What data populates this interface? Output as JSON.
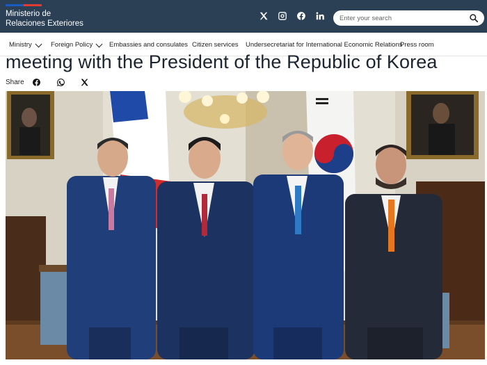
{
  "header": {
    "org_line1": "Ministerio de",
    "org_line2": "Relaciones Exteriores",
    "search_placeholder": "Enter your search",
    "social_icons": [
      "x-icon",
      "instagram-icon",
      "facebook-icon",
      "linkedin-icon"
    ],
    "colors": {
      "bar": "#2b3f55",
      "flag_blue": "#1a5cc4",
      "flag_red": "#e03c31"
    }
  },
  "nav": {
    "items": [
      {
        "label": "Ministry",
        "dropdown": true
      },
      {
        "label": "Foreign Policy",
        "dropdown": true
      },
      {
        "label": "Embassies and consulates",
        "dropdown": false
      },
      {
        "label": "Citizen services",
        "dropdown": false
      },
      {
        "label": "Undersecretariat for International Economic Relations",
        "dropdown": false
      },
      {
        "label": "Press room",
        "dropdown": false
      }
    ]
  },
  "article": {
    "title": "meeting with the President of the Republic of Korea",
    "share_label": "Share",
    "share_icons": [
      "facebook-icon",
      "whatsapp-icon",
      "x-icon"
    ]
  }
}
